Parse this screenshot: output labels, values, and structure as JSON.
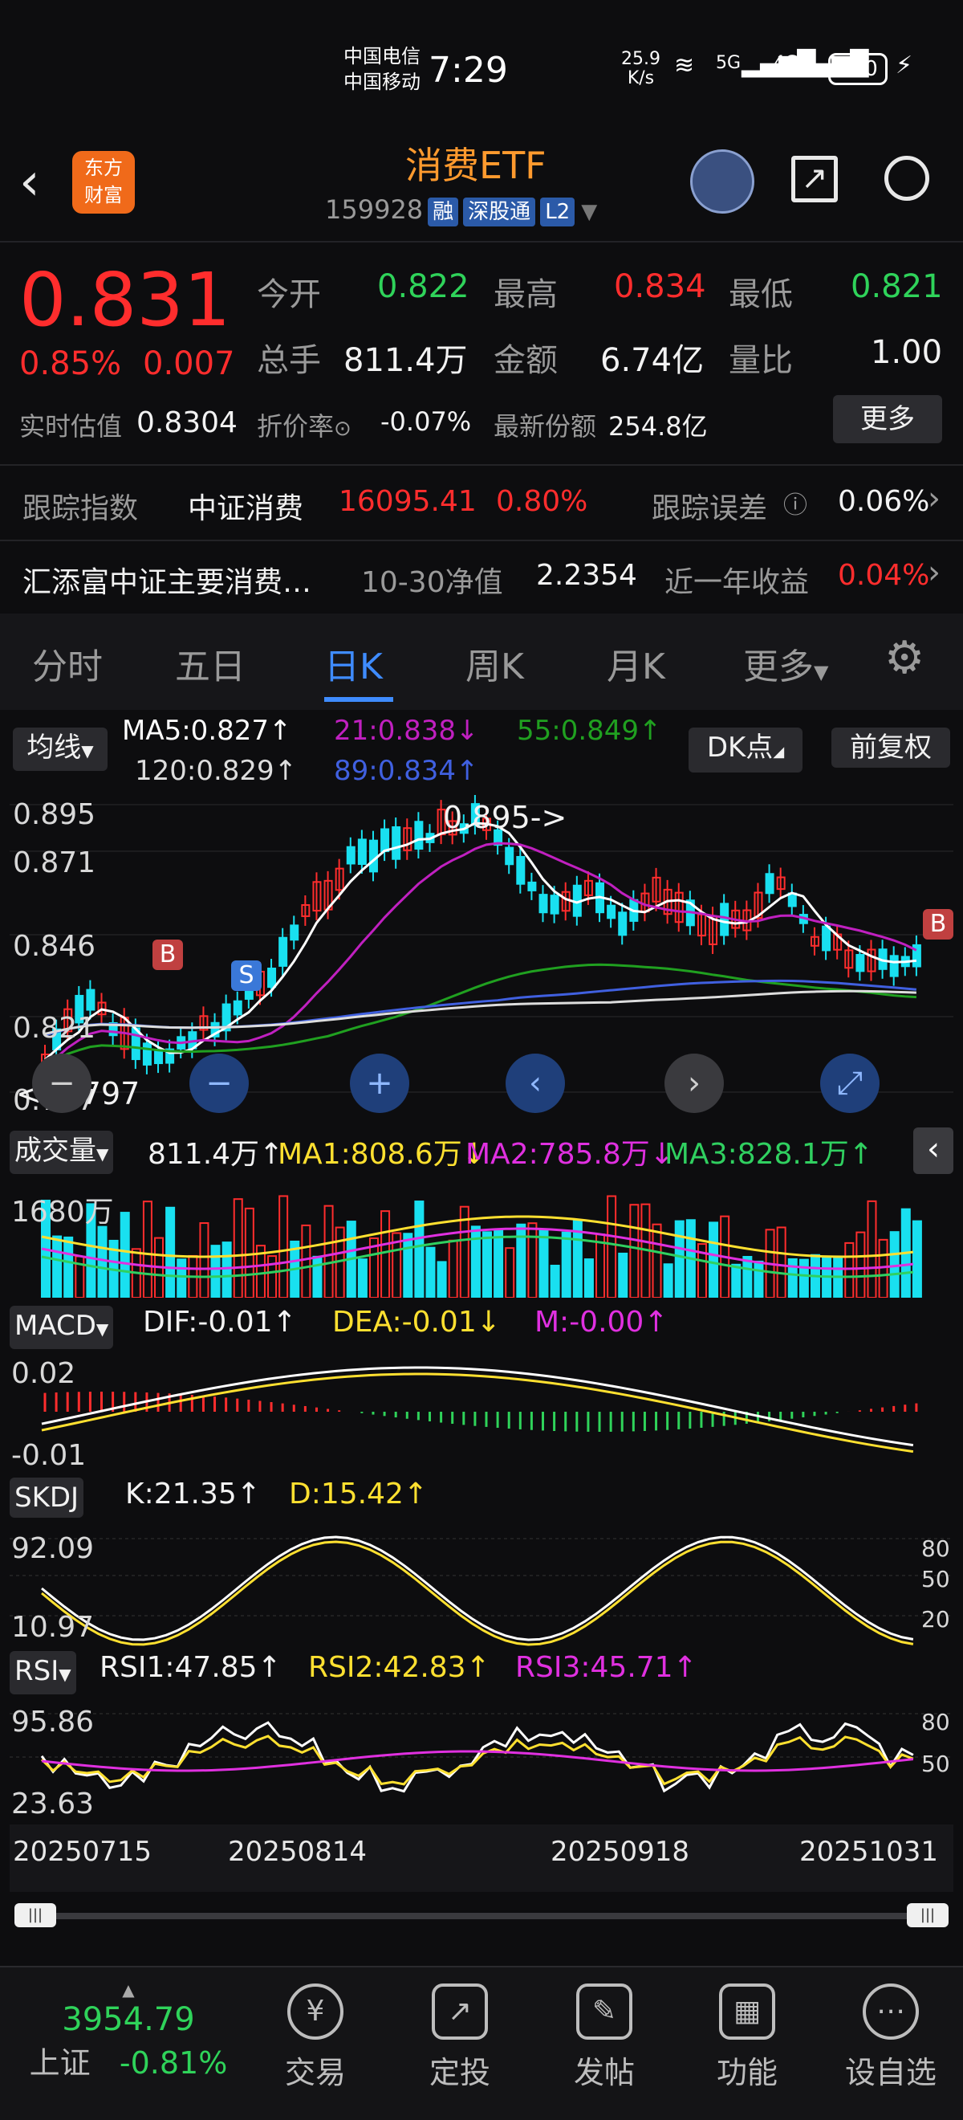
{
  "status": {
    "carrier1": "中国电信",
    "carrier2": "中国移动",
    "time": "7:29",
    "speed": "25.9",
    "speed_unit": "K/s",
    "net1": "5G",
    "net2": "4G",
    "battery": "100"
  },
  "header": {
    "logo_line1": "东方",
    "logo_line2": "财富",
    "title": "消费ETF",
    "code": "159928",
    "tags": [
      "融",
      "深股通",
      "L2"
    ]
  },
  "quote": {
    "price": "0.831",
    "change_pct": "0.85%",
    "change": "0.007",
    "open_label": "今开",
    "open": "0.822",
    "high_label": "最高",
    "high": "0.834",
    "low_label": "最低",
    "low": "0.821",
    "vol_label": "总手",
    "vol": "811.4万",
    "amt_label": "金额",
    "amt": "6.74亿",
    "ratio_label": "量比",
    "ratio": "1.00",
    "iopv_label": "实时估值",
    "iopv": "0.8304",
    "prem_label": "折价率",
    "prem": "-0.07%",
    "share_label": "最新份额",
    "share": "254.8亿",
    "more": "更多"
  },
  "track": {
    "label": "跟踪指数",
    "index": "中证消费",
    "index_val": "16095.41",
    "index_pct": "0.80%",
    "err_label": "跟踪误差",
    "err": "0.06%"
  },
  "fund": {
    "name": "汇添富中证主要消费…",
    "nav_label": "10-30净值",
    "nav": "2.2354",
    "ret_label": "近一年收益",
    "ret": "0.04%"
  },
  "tabs": [
    "分时",
    "五日",
    "日K",
    "周K",
    "月K",
    "更多"
  ],
  "ma": {
    "btn": "均线",
    "ma5": "MA5:0.827↑",
    "ma21": "21:0.838↓",
    "ma55": "55:0.849↑",
    "ma120": "120:0.829↑",
    "ma89": "89:0.834↑",
    "dk": "DK点",
    "adj": "前复权"
  },
  "kchart": {
    "y1": "0.895",
    "y2": "0.871",
    "y3": "0.846",
    "y4": "0.821",
    "y5": "0.797",
    "high_mark": "0.895->",
    "low_mark": "<-0.797",
    "buy": "B",
    "sell": "S",
    "buy2": "B"
  },
  "volume": {
    "btn": "成交量",
    "v": "811.4万↑",
    "ma1": "MA1:808.6万↓",
    "ma2": "MA2:785.8万↓",
    "ma3": "MA3:828.1万↑",
    "max": "1680万"
  },
  "macd": {
    "btn": "MACD",
    "dif": "DIF:-0.01↑",
    "dea": "DEA:-0.01↓",
    "m": "M:-0.00↑",
    "y1": "0.02",
    "y2": "-0.01"
  },
  "kdj": {
    "btn": "SKDJ",
    "k": "K:21.35↑",
    "d": "D:15.42↑",
    "y1": "92.09",
    "y2": "10.97",
    "r1": "80",
    "r2": "50",
    "r3": "20"
  },
  "rsi": {
    "btn": "RSI",
    "r1": "RSI1:47.85↑",
    "r2": "RSI2:42.83↑",
    "r3": "RSI3:45.71↑",
    "y1": "95.86",
    "y2": "23.63",
    "a1": "80",
    "a2": "50"
  },
  "dates": [
    "20250715",
    "20250814",
    "20250918",
    "20251031"
  ],
  "index_bar": {
    "value": "3954.79",
    "name": "上证",
    "pct": "-0.81%"
  },
  "nav": [
    {
      "icon": "¥",
      "label": "交易"
    },
    {
      "icon": "↗",
      "label": "定投"
    },
    {
      "icon": "✎",
      "label": "发帖"
    },
    {
      "icon": "▦",
      "label": "功能"
    },
    {
      "icon": "⋯",
      "label": "设自选"
    }
  ],
  "colors": {
    "up": "#ff2d2d",
    "down": "#2fd35a",
    "ma5": "#ffffff",
    "ma21": "#c020c0",
    "ma55": "#20a020",
    "ma89": "#4060e0",
    "ma120": "#dddddd",
    "accent": "#3f8cff",
    "title": "#ff9a2e"
  }
}
